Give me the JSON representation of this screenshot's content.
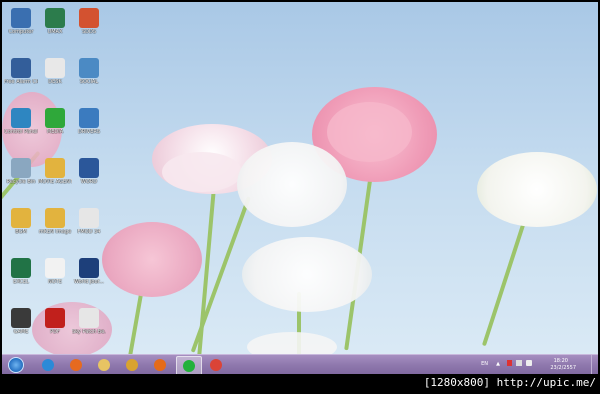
{
  "desktop": {
    "icons": [
      {
        "label": "Computer",
        "icon": "computer-icon",
        "color": "#3a6fb0"
      },
      {
        "label": "UMAX",
        "icon": "scanner-icon",
        "color": "#2c7c4c"
      },
      {
        "label": "SDDS",
        "icon": "powerpoint-icon",
        "color": "#d35230"
      },
      {
        "label": "Free Alarm Clock",
        "icon": "clock-icon",
        "color": "#335e9a"
      },
      {
        "label": "DESK",
        "icon": "document-icon",
        "color": "#e8e8e8"
      },
      {
        "label": "SOCIAL",
        "icon": "users-icon",
        "color": "#4b8ac4"
      },
      {
        "label": "Control Panel",
        "icon": "control-panel-icon",
        "color": "#2e86c1"
      },
      {
        "label": "MEDIA",
        "icon": "media-player-icon",
        "color": "#2fa83a"
      },
      {
        "label": "DRIVERS",
        "icon": "tools-icon",
        "color": "#3b7bbf"
      },
      {
        "label": "Recycle Bin",
        "icon": "recycle-bin-icon",
        "color": "#8aa7c0"
      },
      {
        "label": "MOVIE AGENT",
        "icon": "folder-icon",
        "color": "#e2b33e"
      },
      {
        "label": "WORD",
        "icon": "word-icon",
        "color": "#2b579a"
      },
      {
        "label": "BGM",
        "icon": "folder-icon",
        "color": "#e2b33e"
      },
      {
        "label": "mKEN Image",
        "icon": "folder-icon",
        "color": "#e2b33e"
      },
      {
        "label": "FMOD 34",
        "icon": "pdf-file-icon",
        "color": "#e6e6e6"
      },
      {
        "label": "EXCEL",
        "icon": "excel-icon",
        "color": "#217346"
      },
      {
        "label": "NOTE",
        "icon": "text-file-icon",
        "color": "#f2f2f2"
      },
      {
        "label": "World Jour...",
        "icon": "media-file-icon",
        "color": "#1d3f7a"
      },
      {
        "label": "GAME",
        "icon": "game-character-icon",
        "color": "#3a3a3a"
      },
      {
        "label": "PDF",
        "icon": "acrobat-icon",
        "color": "#c1201c"
      },
      {
        "label": "Sky Patch Be...",
        "icon": "pdf-file-icon",
        "color": "#e6e6e6"
      }
    ]
  },
  "taskbar": {
    "start_label": "Start",
    "items": [
      {
        "name": "internet-explorer-icon",
        "color": "#2a8ad8"
      },
      {
        "name": "firefox-icon",
        "color": "#e66a1f"
      },
      {
        "name": "file-explorer-icon",
        "color": "#e7c463"
      },
      {
        "name": "media-center-icon",
        "color": "#d9a32f"
      },
      {
        "name": "video-player-icon",
        "color": "#e56b1a"
      },
      {
        "name": "line-icon",
        "color": "#23b13b"
      },
      {
        "name": "chrome-icon",
        "color": "#db4437"
      }
    ],
    "tray": {
      "language": "EN",
      "time": "18:20",
      "date": "23/2/2557"
    }
  },
  "caption": "[1280x800] http://upic.me/"
}
